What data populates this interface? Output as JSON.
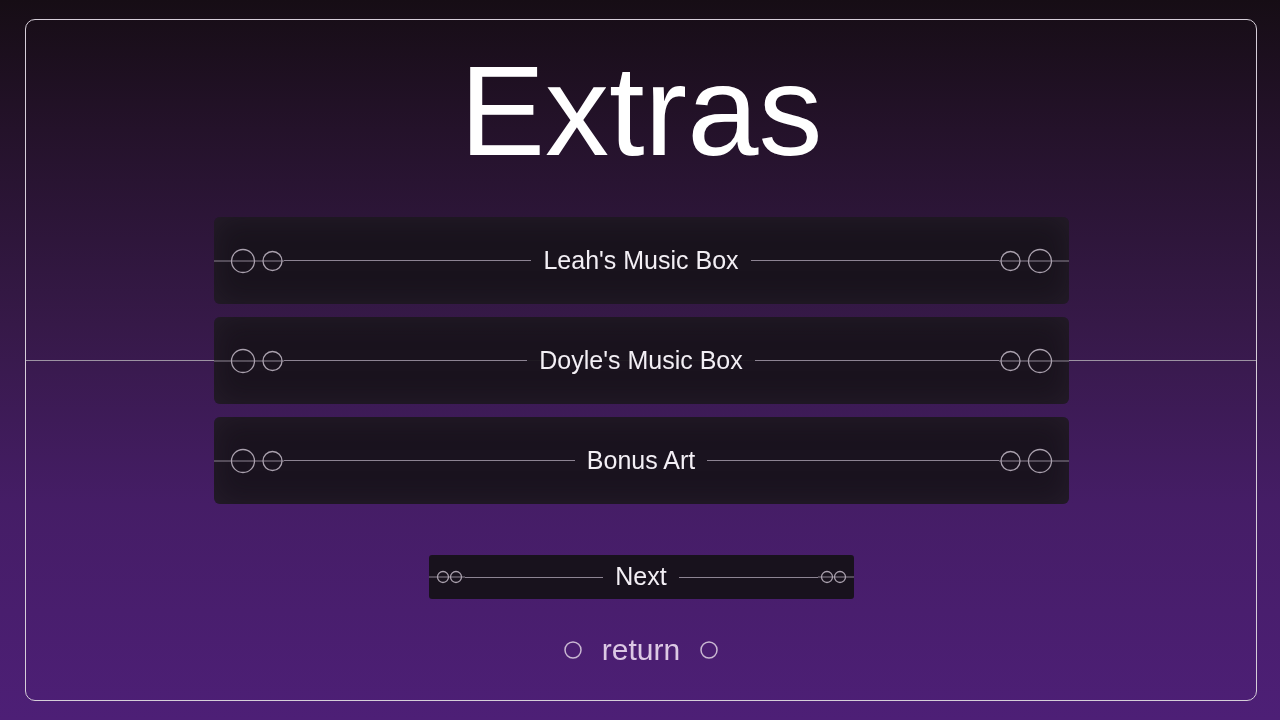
{
  "title": "Extras",
  "menu_items": [
    {
      "label": "Leah's Music Box"
    },
    {
      "label": "Doyle's Music Box"
    },
    {
      "label": "Bonus Art"
    }
  ],
  "next_button": {
    "label": "Next"
  },
  "return_link": {
    "label": "return"
  }
}
